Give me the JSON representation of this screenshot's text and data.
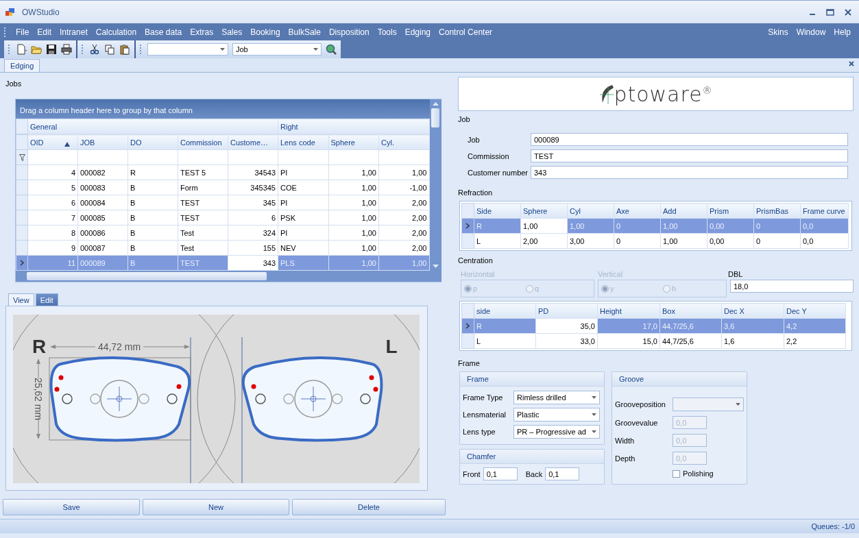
{
  "window": {
    "title": "OWStudio"
  },
  "menu": {
    "left": [
      "File",
      "Edit",
      "Intranet",
      "Calculation",
      "Base data",
      "Extras",
      "Sales",
      "Booking",
      "BulkSale",
      "Disposition",
      "Tools",
      "Edging",
      "Control Center"
    ],
    "right": [
      "Skins",
      "Window",
      "Help"
    ]
  },
  "toolbar": {
    "search_combo_value": "Job"
  },
  "document_tab": {
    "label": "Edging",
    "selected": true
  },
  "jobs": {
    "title": "Jobs",
    "group_panel": "Drag a column header here to group by that column",
    "bands": [
      {
        "label": "General",
        "columns": [
          {
            "label": "OID",
            "sorted": true,
            "focused": false
          },
          {
            "label": "JOB",
            "sorted": false,
            "focused": false
          },
          {
            "label": "DO",
            "sorted": false,
            "focused": false
          },
          {
            "label": "Commission",
            "sorted": false,
            "focused": false
          },
          {
            "label": "Custome…",
            "sorted": false,
            "focused": true
          }
        ]
      },
      {
        "label": "Right",
        "columns": [
          {
            "label": "Lens code",
            "sorted": false,
            "focused": false
          },
          {
            "label": "Sphere",
            "sorted": false,
            "focused": false
          },
          {
            "label": "Cyl.",
            "sorted": false,
            "focused": false
          }
        ]
      }
    ],
    "rows": [
      {
        "selected": false,
        "cells": [
          "4",
          "000082",
          "R",
          "TEST 5",
          "34543",
          "PI",
          "1,00",
          "1,00"
        ]
      },
      {
        "selected": false,
        "cells": [
          "5",
          "000083",
          "B",
          "Form",
          "345345",
          "COE",
          "1,00",
          "-1,00"
        ]
      },
      {
        "selected": false,
        "cells": [
          "6",
          "000084",
          "B",
          "TEST",
          "345",
          "PI",
          "1,00",
          "2,00"
        ]
      },
      {
        "selected": false,
        "cells": [
          "7",
          "000085",
          "B",
          "TEST",
          "6",
          "PSK",
          "1,00",
          "2,00"
        ]
      },
      {
        "selected": false,
        "cells": [
          "8",
          "000086",
          "B",
          "Test",
          "324",
          "PI",
          "1,00",
          "2,00"
        ]
      },
      {
        "selected": false,
        "cells": [
          "9",
          "000087",
          "B",
          "Test",
          "155",
          "NEV",
          "1,00",
          "2,00"
        ]
      },
      {
        "selected": true,
        "cells": [
          "11",
          "000089",
          "B",
          "TEST",
          "343",
          "PLS",
          "1,00",
          "1,00"
        ]
      }
    ]
  },
  "view_tabs": [
    {
      "label": "View",
      "selected": true
    },
    {
      "label": "Edit",
      "selected": false
    }
  ],
  "drawing": {
    "right_label": "R",
    "left_label": "L",
    "width": "44,72 mm",
    "height": "25,62 mm"
  },
  "buttons": [
    "Save",
    "New",
    "Delete"
  ],
  "logo": "ptoware$^{®}$",
  "job": {
    "title": "Job",
    "fields": [
      {
        "label": "Job",
        "value": "000089"
      },
      {
        "label": "Commission",
        "value": "TEST"
      },
      {
        "label": "Customer number",
        "value": "343"
      }
    ]
  },
  "refraction": {
    "title": "Refraction",
    "columns": [
      {
        "label": "Side",
        "focused": false
      },
      {
        "label": "Sphere",
        "focused": true
      },
      {
        "label": "Cyl",
        "focused": false
      },
      {
        "label": "Axe",
        "focused": false
      },
      {
        "label": "Add",
        "focused": false
      },
      {
        "label": "Prism",
        "focused": false
      },
      {
        "label": "PrismBas",
        "focused": false
      },
      {
        "label": "Frame curve",
        "focused": false
      }
    ],
    "rows": [
      {
        "selected": true,
        "cells": [
          "R",
          "1,00",
          "1,00",
          "0",
          "1,00",
          "0,00",
          "0",
          "0,0"
        ]
      },
      {
        "selected": false,
        "cells": [
          "L",
          "2,00",
          "3,00",
          "0",
          "1,00",
          "0,00",
          "0",
          "0,0"
        ]
      }
    ]
  },
  "centration": {
    "title": "Centration",
    "horizontal": {
      "label": "Horizontal",
      "disabled": true,
      "options": [
        {
          "label": "p",
          "selected": true
        },
        {
          "label": "q",
          "selected": false
        }
      ]
    },
    "vertical": {
      "label": "Vertical",
      "disabled": true,
      "options": [
        {
          "label": "y",
          "selected": true
        },
        {
          "label": "h",
          "selected": false
        }
      ]
    },
    "dbl": {
      "label": "DBL",
      "value": "18,0"
    },
    "columns": [
      {
        "label": "side",
        "focused": false
      },
      {
        "label": "PD",
        "focused": true
      },
      {
        "label": "Height",
        "focused": false
      },
      {
        "label": "Box",
        "focused": false
      },
      {
        "label": "Dec X",
        "focused": false
      },
      {
        "label": "Dec Y",
        "focused": false
      }
    ],
    "rows": [
      {
        "selected": true,
        "cells": [
          "R",
          "35,0",
          "17,0",
          "44,7/25,6",
          "3,6",
          "4,2"
        ]
      },
      {
        "selected": false,
        "cells": [
          "L",
          "33,0",
          "15,0",
          "44,7/25,6",
          "1,6",
          "2,2"
        ]
      }
    ]
  },
  "frame": {
    "title": "Frame",
    "frame_group": {
      "title": "Frame",
      "fields": [
        {
          "label": "Frame Type",
          "value": "Rimless drilled"
        },
        {
          "label": "Lensmaterial",
          "value": "Plastic"
        },
        {
          "label": "Lens type",
          "value": "PR – Progressive ad"
        }
      ]
    },
    "chamfer": {
      "title": "Chamfer",
      "fields": [
        {
          "label": "Front",
          "value": "0,1"
        },
        {
          "label": "Back",
          "value": "0,1"
        }
      ]
    },
    "groove": {
      "title": "Groove",
      "position": {
        "label": "Grooveposition",
        "disabled": true
      },
      "fields": [
        {
          "label": "Groovevalue",
          "value": "0,0",
          "disabled": true
        },
        {
          "label": "Width",
          "value": "0,0",
          "disabled": true
        },
        {
          "label": "Depth",
          "value": "0,0",
          "disabled": true
        }
      ],
      "polishing": {
        "label": "Polishing",
        "checked": false
      }
    }
  },
  "status_bar": {
    "queues": "Queues: -1/0"
  }
}
